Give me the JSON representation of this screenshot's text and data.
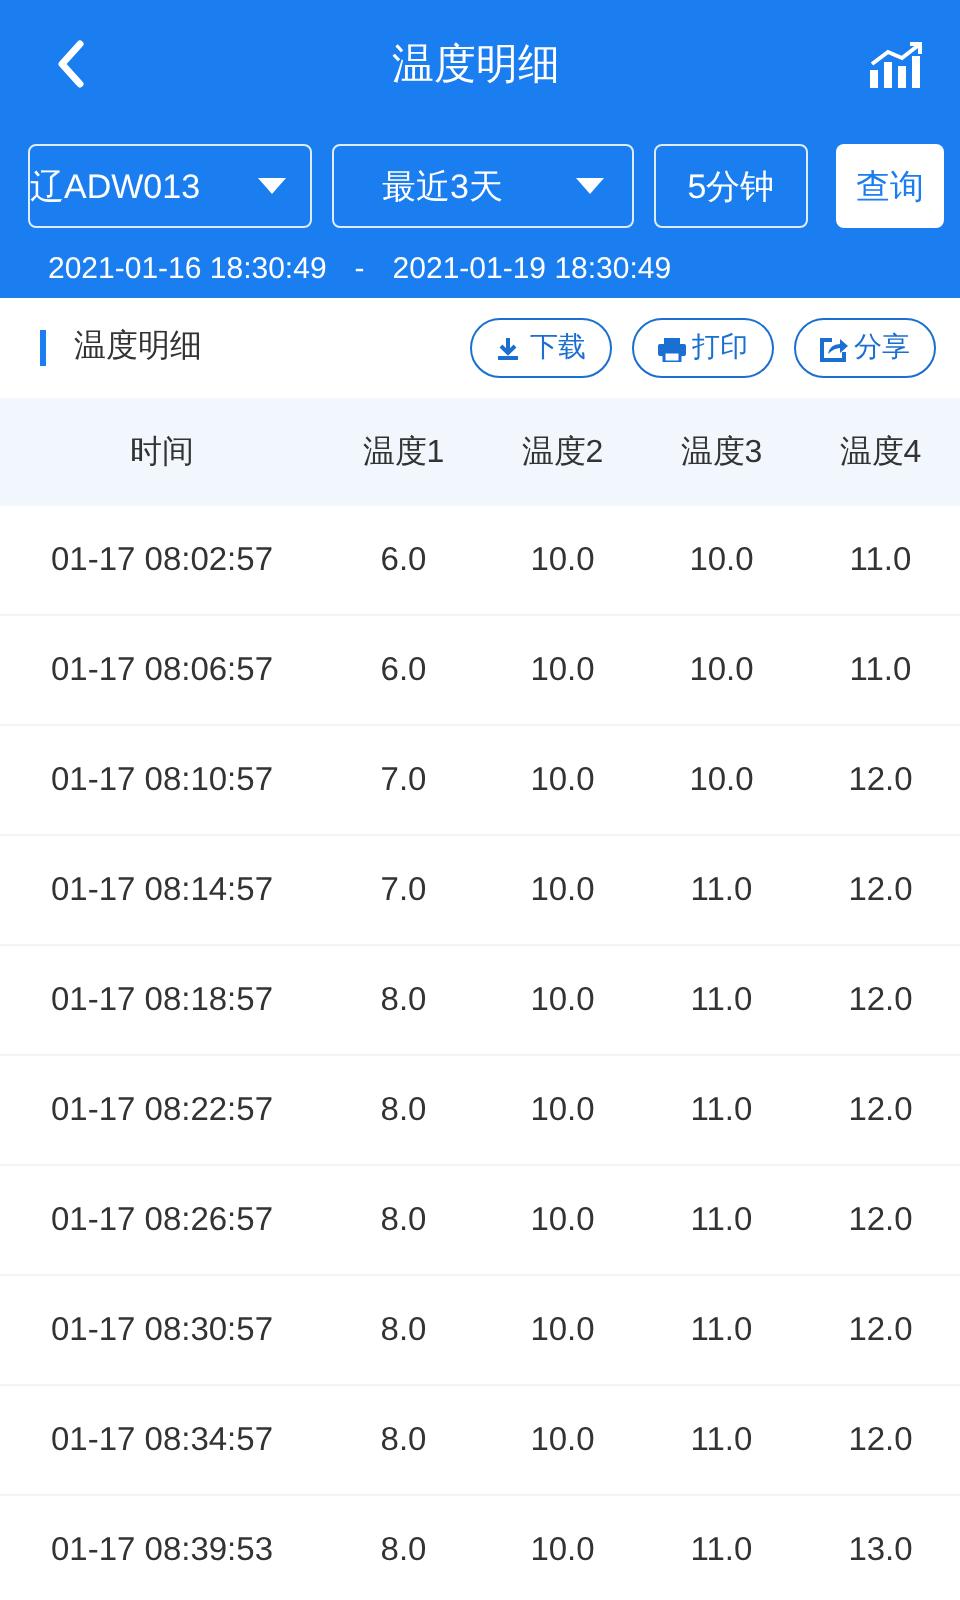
{
  "header": {
    "title": "温度明细"
  },
  "filters": {
    "device": "辽ADW013",
    "period": "最近3天",
    "interval": "5分钟",
    "query_button": "查询"
  },
  "date_range": {
    "start": "2021-01-16 18:30:49",
    "separator": "-",
    "end": "2021-01-19 18:30:49"
  },
  "section": {
    "title": "温度明细",
    "actions": [
      {
        "kind": "download",
        "label": "下载"
      },
      {
        "kind": "print",
        "label": "打印"
      },
      {
        "kind": "share",
        "label": "分享"
      }
    ]
  },
  "table": {
    "columns": [
      "时间",
      "温度1",
      "温度2",
      "温度3",
      "温度4"
    ],
    "rows": [
      [
        "01-17 08:02:57",
        "6.0",
        "10.0",
        "10.0",
        "11.0"
      ],
      [
        "01-17 08:06:57",
        "6.0",
        "10.0",
        "10.0",
        "11.0"
      ],
      [
        "01-17 08:10:57",
        "7.0",
        "10.0",
        "10.0",
        "12.0"
      ],
      [
        "01-17 08:14:57",
        "7.0",
        "10.0",
        "11.0",
        "12.0"
      ],
      [
        "01-17 08:18:57",
        "8.0",
        "10.0",
        "11.0",
        "12.0"
      ],
      [
        "01-17 08:22:57",
        "8.0",
        "10.0",
        "11.0",
        "12.0"
      ],
      [
        "01-17 08:26:57",
        "8.0",
        "10.0",
        "11.0",
        "12.0"
      ],
      [
        "01-17 08:30:57",
        "8.0",
        "10.0",
        "11.0",
        "12.0"
      ],
      [
        "01-17 08:34:57",
        "8.0",
        "10.0",
        "11.0",
        "12.0"
      ],
      [
        "01-17 08:39:53",
        "8.0",
        "10.0",
        "11.0",
        "13.0"
      ]
    ]
  }
}
